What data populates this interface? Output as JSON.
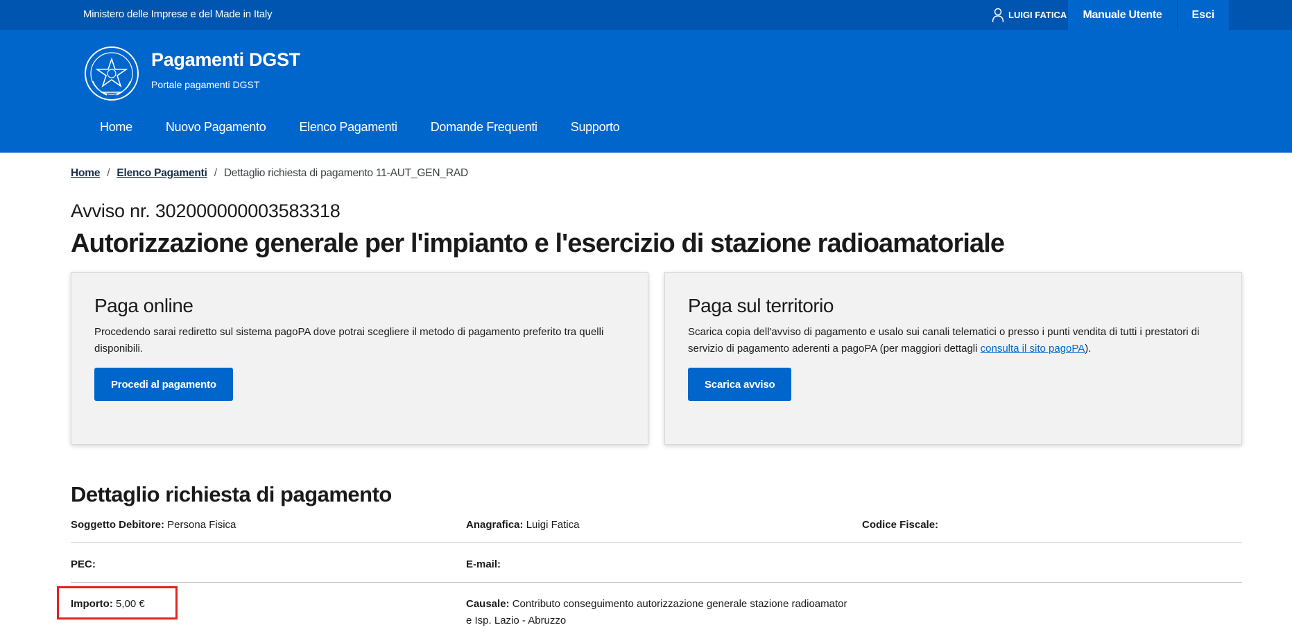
{
  "slim_header": {
    "ministry": "Ministero delle Imprese e del Made in Italy",
    "user_name": "LUIGI FATICA",
    "manual_label": "Manuale Utente",
    "exit_label": "Esci"
  },
  "brand": {
    "title": "Pagamenti DGST",
    "subtitle": "Portale pagamenti DGST"
  },
  "nav": [
    {
      "label": "Home"
    },
    {
      "label": "Nuovo Pagamento"
    },
    {
      "label": "Elenco Pagamenti"
    },
    {
      "label": "Domande Frequenti"
    },
    {
      "label": "Supporto"
    }
  ],
  "breadcrumb": {
    "home": "Home",
    "list": "Elenco Pagamenti",
    "current": "Dettaglio richiesta di pagamento 11-AUT_GEN_RAD",
    "separator": "/"
  },
  "notice": {
    "number_label": "Avviso nr. 302000000003583318",
    "title": "Autorizzazione generale per l'impianto e l'esercizio di stazione radioamatoriale"
  },
  "online_card": {
    "title": "Paga online",
    "text": "Procedendo sarai rediretto sul sistema pagoPA dove potrai scegliere il metodo di pagamento preferito tra quelli disponibili.",
    "button": "Procedi al pagamento"
  },
  "territory_card": {
    "title": "Paga sul territorio",
    "text_before": "Scarica copia dell'avviso di pagamento e usalo sui canali telematici o presso i punti vendita di tutti i prestatori di servizio di pagamento aderenti a pagoPA (per maggiori dettagli ",
    "link": "consulta il sito pagoPA",
    "text_after": ").",
    "button": "Scarica avviso"
  },
  "detail": {
    "title": "Dettaglio richiesta di pagamento",
    "soggetto_label": "Soggetto Debitore:",
    "soggetto_value": "Persona Fisica",
    "anagrafica_label": "Anagrafica:",
    "anagrafica_value": "Luigi Fatica",
    "codice_label": "Codice Fiscale:",
    "codice_value": "",
    "pec_label": "PEC:",
    "pec_value": "",
    "email_label": "E-mail:",
    "email_value": "",
    "importo_label": "Importo:",
    "importo_value": "5,00 €",
    "causale_label": "Causale:",
    "causale_value": "Contributo conseguimento autorizzazione generale stazione radioamatore Isp. Lazio - Abruzzo"
  },
  "colors": {
    "slim_bg": "#0055b0",
    "header_bg": "#0066cc",
    "primary": "#0066cc",
    "highlight": "#e32222"
  }
}
